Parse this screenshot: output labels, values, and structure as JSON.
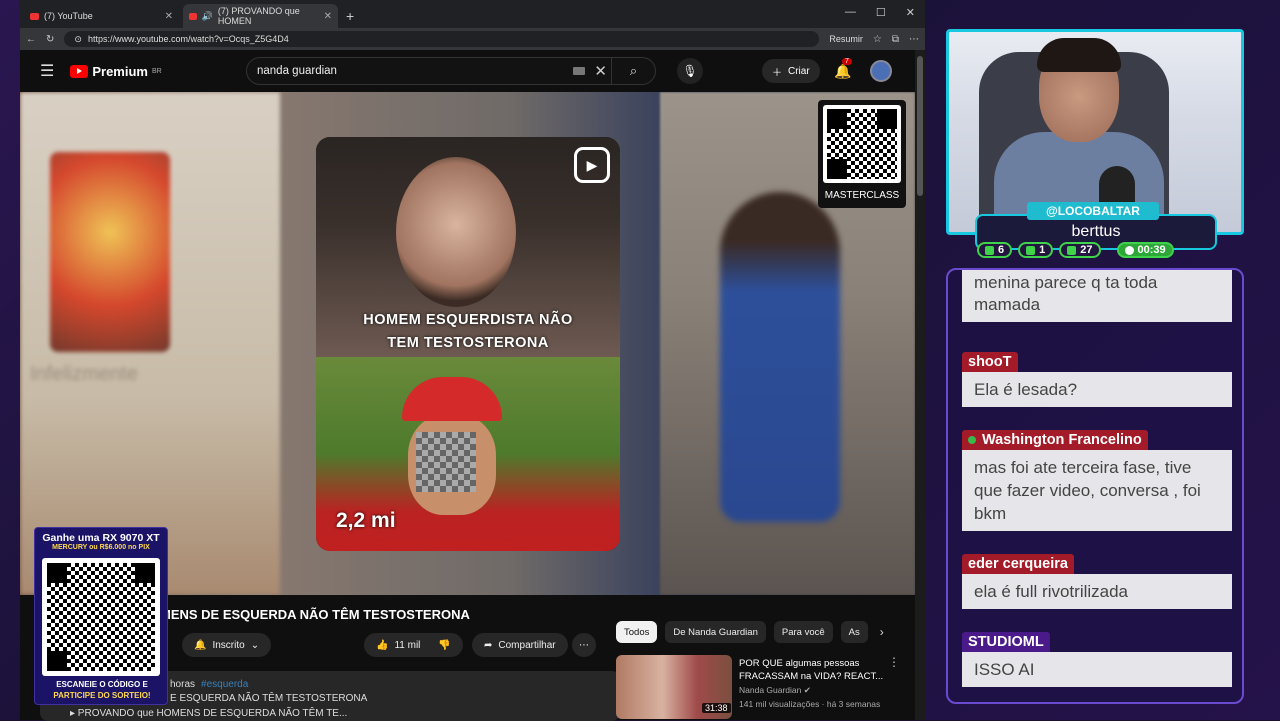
{
  "browser": {
    "tabs": [
      {
        "title": "(7) YouTube",
        "close": "✕"
      },
      {
        "title": "(7) PROVANDO que HOMEN",
        "close": "✕"
      }
    ],
    "new_tab": "+",
    "window_controls": [
      "—",
      "☐",
      "✕"
    ],
    "url": "https://www.youtube.com/watch?v=Ocqs_Z5G4D4",
    "resumir": "Resumir"
  },
  "youtube": {
    "logo": "Premium",
    "region": "BR",
    "search_value": "nanda guardian",
    "criar": "Criar",
    "notif_count": "7"
  },
  "video": {
    "short_caption_1": "HOMEM ESQUERDISTA NÃO",
    "short_caption_2": "TEM TESTOSTERONA",
    "short_views": "2,2 mi",
    "qr_label": "MASTERCLASS",
    "blur_text": "Infelizmente"
  },
  "below": {
    "title": "MENS DE ESQUERDA NÃO TÊM TESTOSTERONA",
    "subscribed": "Inscrito",
    "likes": "11 mil",
    "share": "Compartilhar",
    "desc_time": "horas",
    "desc_tag": "#esquerda",
    "desc_line2": "E ESQUERDA NÃO TÊM TESTOSTERONA",
    "desc_line3": "▸ PROVANDO que HOMENS DE ESQUERDA NÃO TÊM TE...",
    "chips": [
      "Todos",
      "De Nanda Guardian",
      "Para você",
      "As"
    ],
    "rec": {
      "title": "POR QUE algumas pessoas FRACASSAM na VIDA? REACT...",
      "channel": "Nanda Guardian",
      "stats": "141 mil visualizações · há 3 semanas",
      "duration": "31:38"
    }
  },
  "promo": {
    "line1": "Ganhe uma RX 9070 XT",
    "line2": "MERCURY ou R$6.000 no PIX",
    "footer1": "ESCANEIE O CÓDIGO E",
    "footer2": "PARTICIPE DO SORTEIO!"
  },
  "stream": {
    "handle": "@LOCOBALTAR",
    "username": "berttus",
    "stats": [
      "6",
      "1",
      "27"
    ],
    "timer": "00:39"
  },
  "chat": [
    {
      "name": "",
      "text": "menina parece q ta toda mamada"
    },
    {
      "name": "shooT",
      "text": "Ela é lesada?"
    },
    {
      "name": "Washington Francelino",
      "text": "mas foi ate terceira fase, tive que fazer video, conversa , foi bkm"
    },
    {
      "name": "eder cerqueira",
      "text": "ela é full rivotrilizada"
    },
    {
      "name": "STUDIOML",
      "text": "ISSO AI"
    }
  ],
  "colors": {
    "accent_cyan": "#18c7e0",
    "accent_green": "#3ed34a",
    "yt_red": "#ff0000",
    "chat_purple": "#6a4bd0"
  }
}
